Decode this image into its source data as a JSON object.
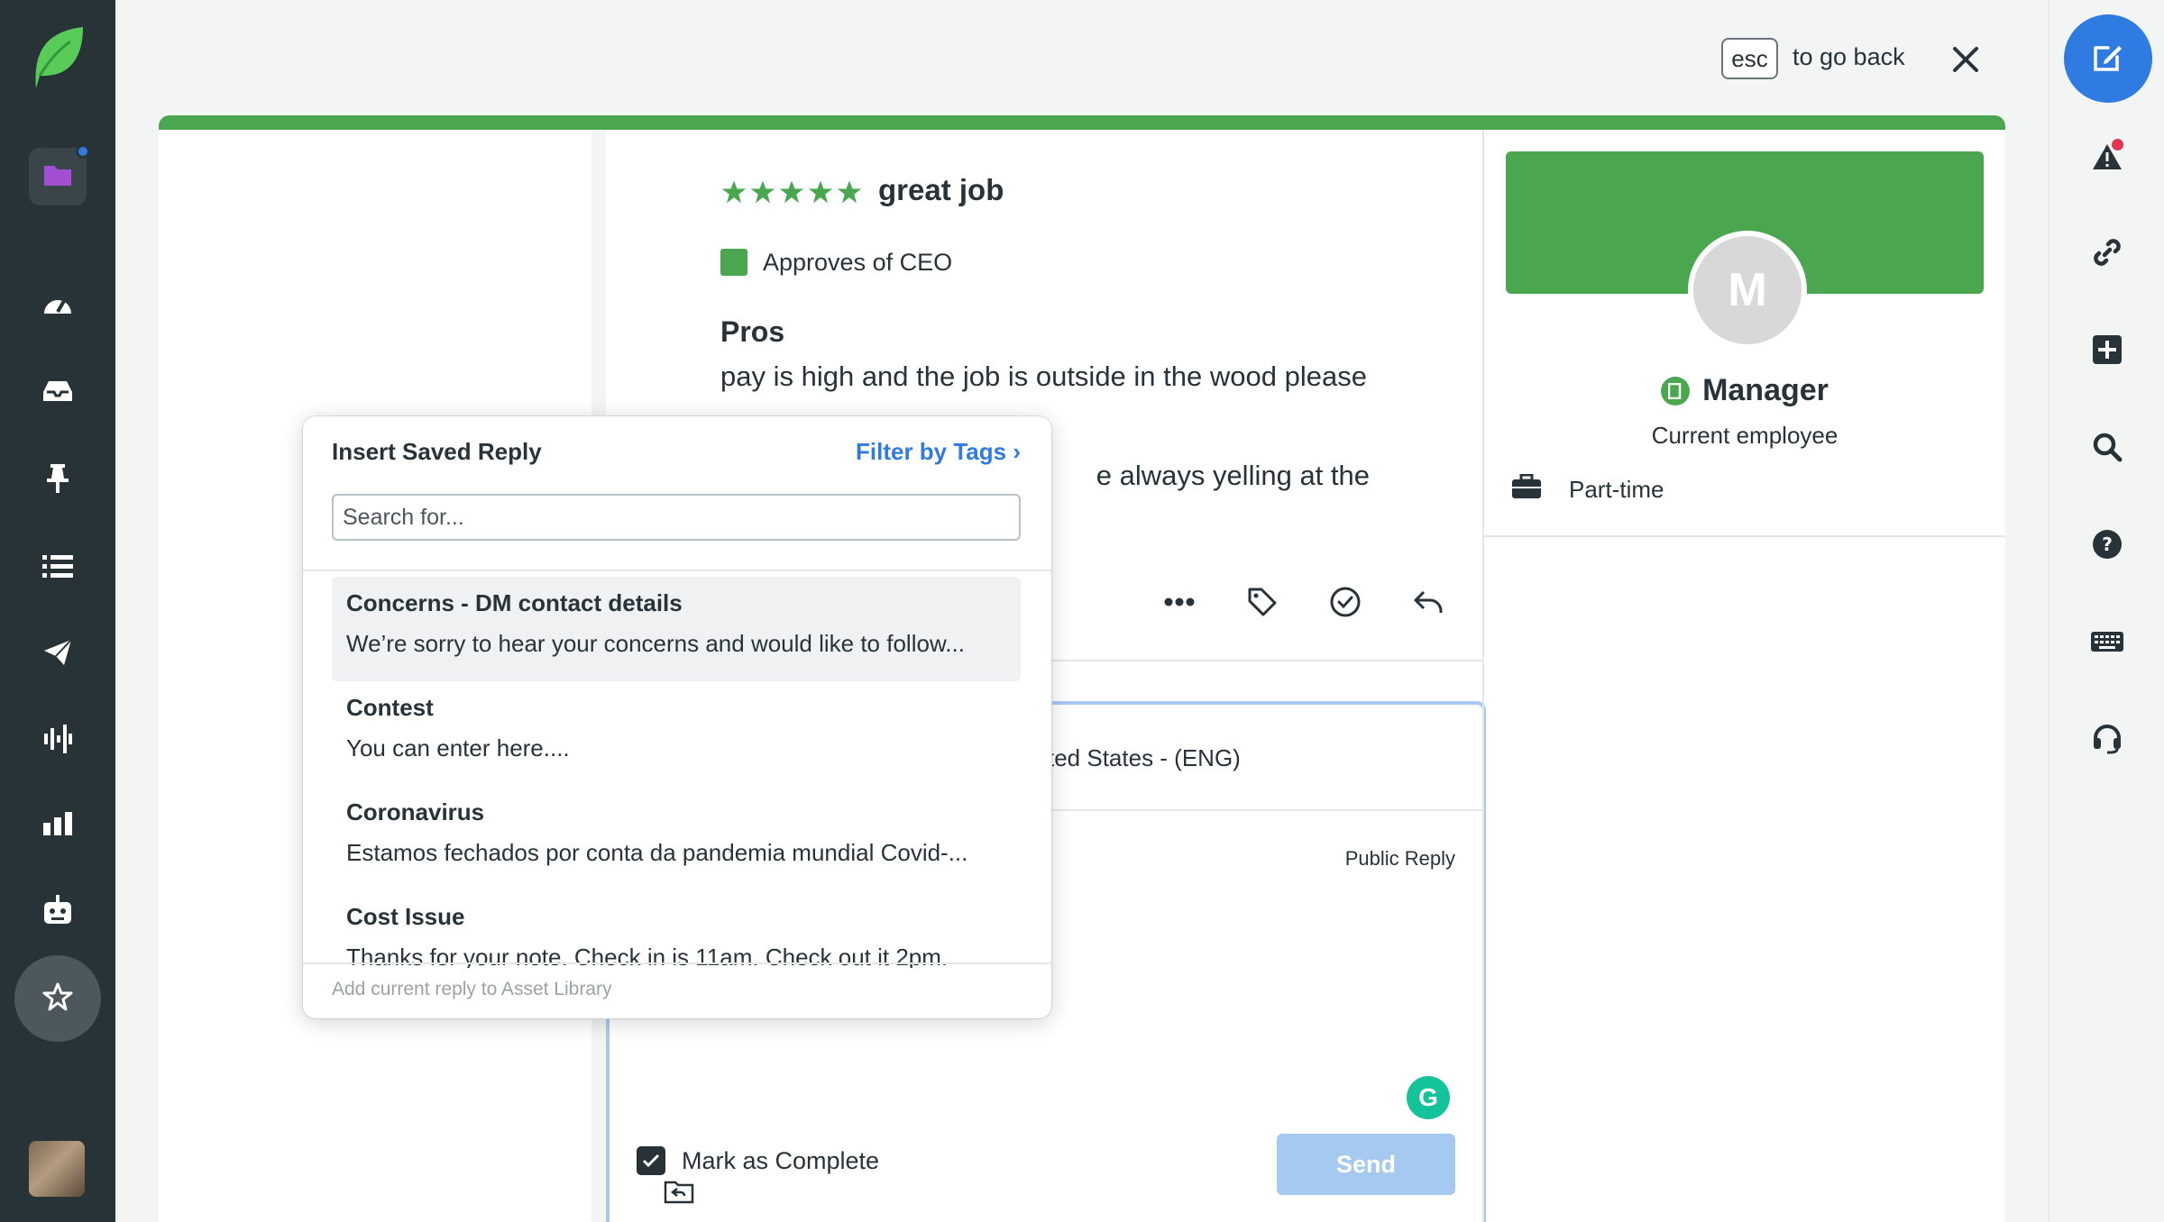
{
  "topbar": {
    "esc_key": "esc",
    "esc_text": "to go back"
  },
  "review": {
    "rating": 5,
    "title": "great job",
    "approves": "Approves of CEO",
    "pros_heading": "Pros",
    "pros_text": "pay is high and the job is outside in the wood please",
    "cons_text_partial": "e always yelling at the"
  },
  "reply": {
    "language_partial": "ted States - (ENG)",
    "mode": "Public Reply",
    "mark_complete_label": "Mark as Complete",
    "send_label": "Send"
  },
  "profile": {
    "initial": "M",
    "role": "Manager",
    "status": "Current employee",
    "employment": "Part-time"
  },
  "saved_reply_popup": {
    "title": "Insert Saved Reply",
    "filter_label": "Filter by Tags ›",
    "search_placeholder": "Search for...",
    "items": [
      {
        "title": "Concerns - DM contact details",
        "text": "We’re sorry to hear your concerns and would like to follow..."
      },
      {
        "title": "Contest",
        "text": "You can enter here...."
      },
      {
        "title": "Coronavirus",
        "text": "Estamos fechados por conta da pandemia mundial Covid-..."
      },
      {
        "title": "Cost Issue",
        "text": "Thanks for your note. Check in is 11am. Check out it 2pm."
      }
    ],
    "footer": "Add current reply to Asset Library"
  },
  "colors": {
    "brand_green": "#4aa74f",
    "nav_dark": "#283338",
    "accent_blue": "#2f7be2",
    "send_disabled": "#a6c9ef"
  },
  "icons": {
    "left_nav": [
      "folder-icon",
      "gauge-icon",
      "inbox-icon",
      "pin-icon",
      "list-icon",
      "paper-plane-icon",
      "waveform-icon",
      "bar-chart-icon",
      "robot-icon",
      "star-icon"
    ],
    "right_rail": [
      "compose-icon",
      "alert-icon",
      "link-icon",
      "plus-icon",
      "search-icon",
      "help-icon",
      "keyboard-icon",
      "headset-icon"
    ]
  }
}
